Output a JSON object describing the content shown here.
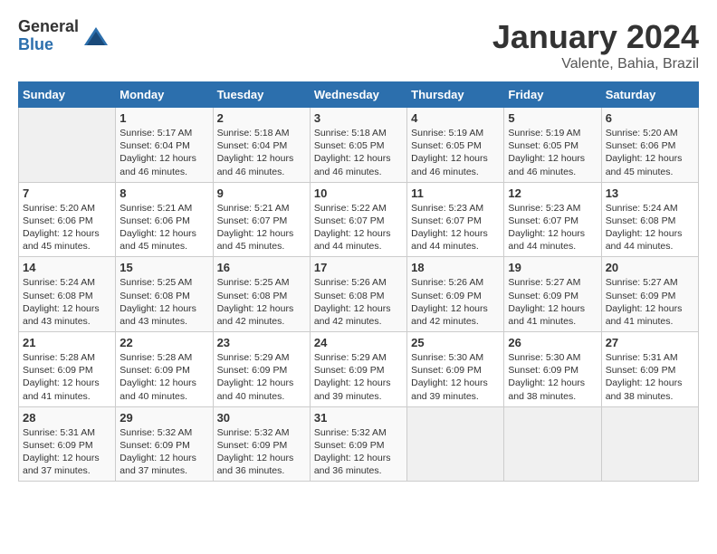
{
  "logo": {
    "general": "General",
    "blue": "Blue"
  },
  "title": "January 2024",
  "location": "Valente, Bahia, Brazil",
  "days_of_week": [
    "Sunday",
    "Monday",
    "Tuesday",
    "Wednesday",
    "Thursday",
    "Friday",
    "Saturday"
  ],
  "weeks": [
    [
      {
        "num": "",
        "info": ""
      },
      {
        "num": "1",
        "info": "Sunrise: 5:17 AM\nSunset: 6:04 PM\nDaylight: 12 hours\nand 46 minutes."
      },
      {
        "num": "2",
        "info": "Sunrise: 5:18 AM\nSunset: 6:04 PM\nDaylight: 12 hours\nand 46 minutes."
      },
      {
        "num": "3",
        "info": "Sunrise: 5:18 AM\nSunset: 6:05 PM\nDaylight: 12 hours\nand 46 minutes."
      },
      {
        "num": "4",
        "info": "Sunrise: 5:19 AM\nSunset: 6:05 PM\nDaylight: 12 hours\nand 46 minutes."
      },
      {
        "num": "5",
        "info": "Sunrise: 5:19 AM\nSunset: 6:05 PM\nDaylight: 12 hours\nand 46 minutes."
      },
      {
        "num": "6",
        "info": "Sunrise: 5:20 AM\nSunset: 6:06 PM\nDaylight: 12 hours\nand 45 minutes."
      }
    ],
    [
      {
        "num": "7",
        "info": "Sunrise: 5:20 AM\nSunset: 6:06 PM\nDaylight: 12 hours\nand 45 minutes."
      },
      {
        "num": "8",
        "info": "Sunrise: 5:21 AM\nSunset: 6:06 PM\nDaylight: 12 hours\nand 45 minutes."
      },
      {
        "num": "9",
        "info": "Sunrise: 5:21 AM\nSunset: 6:07 PM\nDaylight: 12 hours\nand 45 minutes."
      },
      {
        "num": "10",
        "info": "Sunrise: 5:22 AM\nSunset: 6:07 PM\nDaylight: 12 hours\nand 44 minutes."
      },
      {
        "num": "11",
        "info": "Sunrise: 5:23 AM\nSunset: 6:07 PM\nDaylight: 12 hours\nand 44 minutes."
      },
      {
        "num": "12",
        "info": "Sunrise: 5:23 AM\nSunset: 6:07 PM\nDaylight: 12 hours\nand 44 minutes."
      },
      {
        "num": "13",
        "info": "Sunrise: 5:24 AM\nSunset: 6:08 PM\nDaylight: 12 hours\nand 44 minutes."
      }
    ],
    [
      {
        "num": "14",
        "info": "Sunrise: 5:24 AM\nSunset: 6:08 PM\nDaylight: 12 hours\nand 43 minutes."
      },
      {
        "num": "15",
        "info": "Sunrise: 5:25 AM\nSunset: 6:08 PM\nDaylight: 12 hours\nand 43 minutes."
      },
      {
        "num": "16",
        "info": "Sunrise: 5:25 AM\nSunset: 6:08 PM\nDaylight: 12 hours\nand 42 minutes."
      },
      {
        "num": "17",
        "info": "Sunrise: 5:26 AM\nSunset: 6:08 PM\nDaylight: 12 hours\nand 42 minutes."
      },
      {
        "num": "18",
        "info": "Sunrise: 5:26 AM\nSunset: 6:09 PM\nDaylight: 12 hours\nand 42 minutes."
      },
      {
        "num": "19",
        "info": "Sunrise: 5:27 AM\nSunset: 6:09 PM\nDaylight: 12 hours\nand 41 minutes."
      },
      {
        "num": "20",
        "info": "Sunrise: 5:27 AM\nSunset: 6:09 PM\nDaylight: 12 hours\nand 41 minutes."
      }
    ],
    [
      {
        "num": "21",
        "info": "Sunrise: 5:28 AM\nSunset: 6:09 PM\nDaylight: 12 hours\nand 41 minutes."
      },
      {
        "num": "22",
        "info": "Sunrise: 5:28 AM\nSunset: 6:09 PM\nDaylight: 12 hours\nand 40 minutes."
      },
      {
        "num": "23",
        "info": "Sunrise: 5:29 AM\nSunset: 6:09 PM\nDaylight: 12 hours\nand 40 minutes."
      },
      {
        "num": "24",
        "info": "Sunrise: 5:29 AM\nSunset: 6:09 PM\nDaylight: 12 hours\nand 39 minutes."
      },
      {
        "num": "25",
        "info": "Sunrise: 5:30 AM\nSunset: 6:09 PM\nDaylight: 12 hours\nand 39 minutes."
      },
      {
        "num": "26",
        "info": "Sunrise: 5:30 AM\nSunset: 6:09 PM\nDaylight: 12 hours\nand 38 minutes."
      },
      {
        "num": "27",
        "info": "Sunrise: 5:31 AM\nSunset: 6:09 PM\nDaylight: 12 hours\nand 38 minutes."
      }
    ],
    [
      {
        "num": "28",
        "info": "Sunrise: 5:31 AM\nSunset: 6:09 PM\nDaylight: 12 hours\nand 37 minutes."
      },
      {
        "num": "29",
        "info": "Sunrise: 5:32 AM\nSunset: 6:09 PM\nDaylight: 12 hours\nand 37 minutes."
      },
      {
        "num": "30",
        "info": "Sunrise: 5:32 AM\nSunset: 6:09 PM\nDaylight: 12 hours\nand 36 minutes."
      },
      {
        "num": "31",
        "info": "Sunrise: 5:32 AM\nSunset: 6:09 PM\nDaylight: 12 hours\nand 36 minutes."
      },
      {
        "num": "",
        "info": ""
      },
      {
        "num": "",
        "info": ""
      },
      {
        "num": "",
        "info": ""
      }
    ]
  ]
}
